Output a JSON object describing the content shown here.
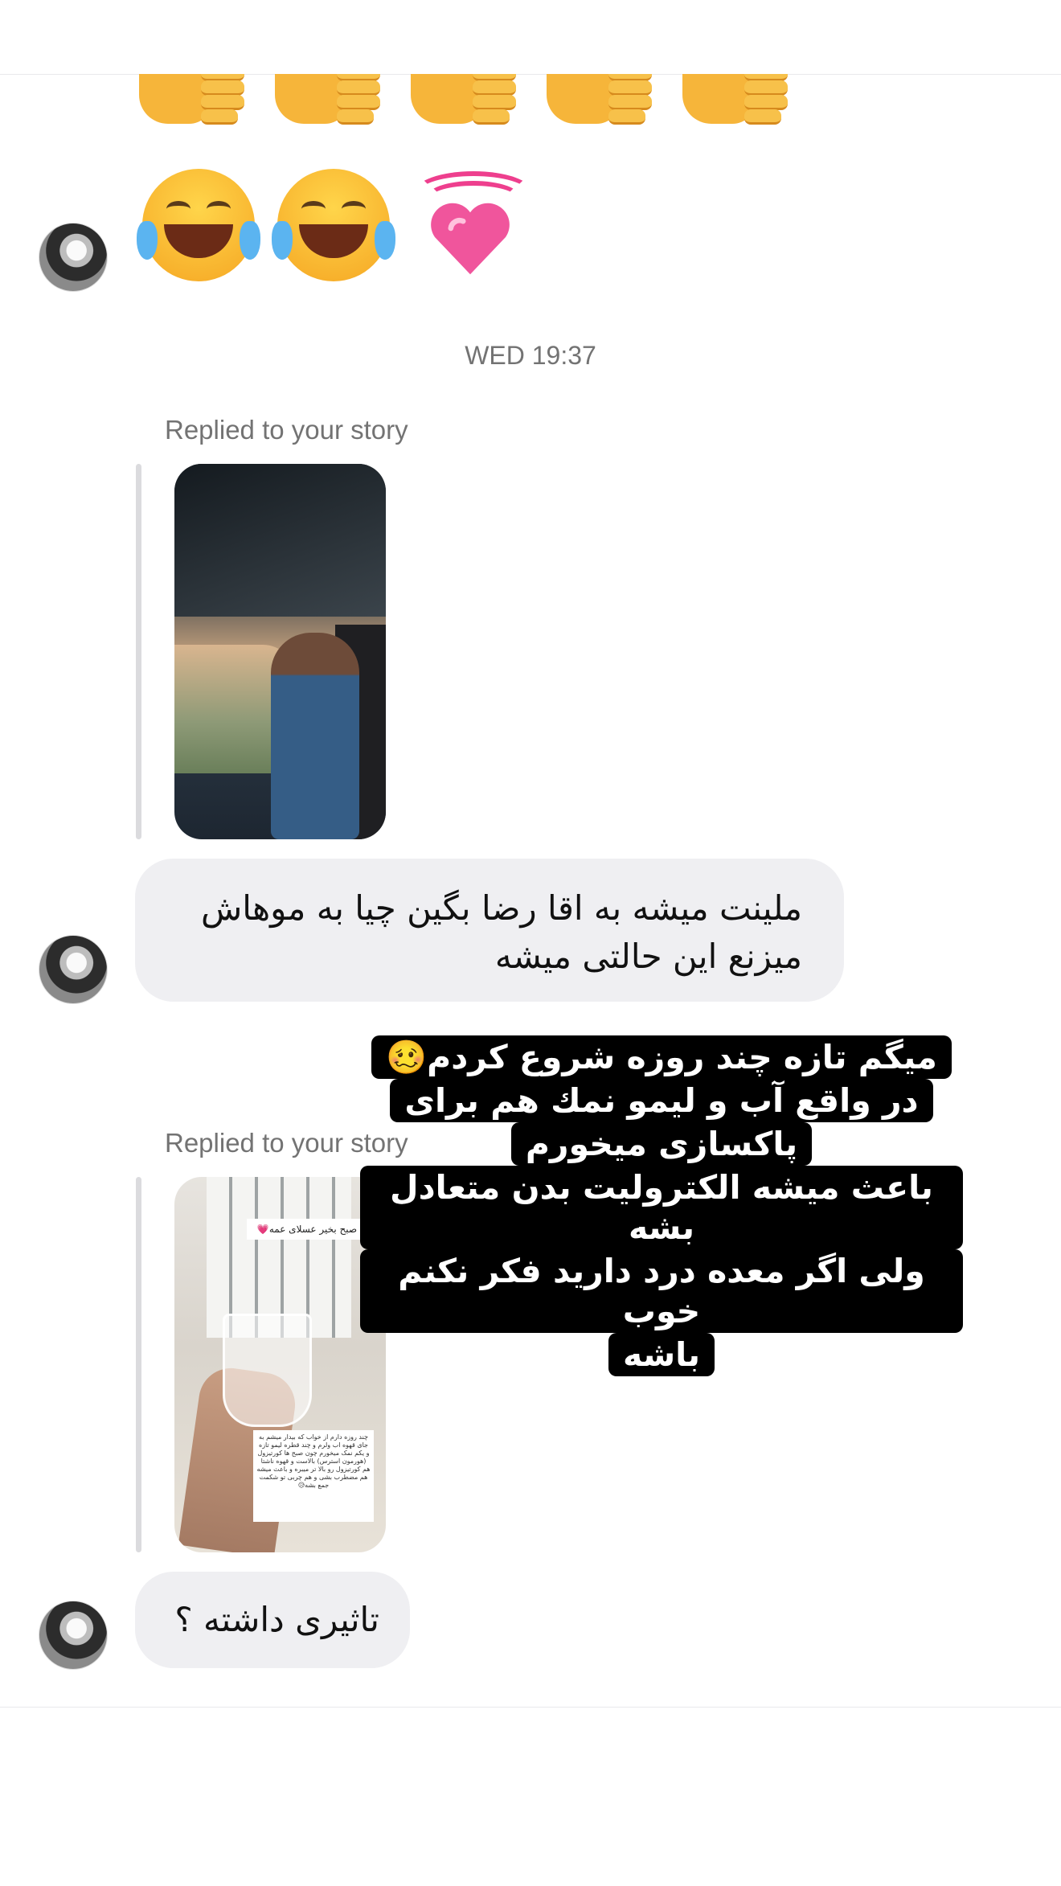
{
  "thread": {
    "timestamp": "WED 19:37",
    "reply1": {
      "label": "Replied to your story",
      "message": "ملینت میشه به اقا رضا بگین چیا به موهاش میزنع این حالتی میشه"
    },
    "reply2": {
      "label": "Replied to your story",
      "story_tag": "صبح بخیر عسلای عمه💗",
      "story_caption": "چند روزه دارم از خواب که بیدار میشم به جای قهوه اب ولرم و چند قطره لیمو تازه و یکم نمک میخورم چون صبح ها کورتیزول (هورمون استرس) بالاست و قهوه ناشتا هم کورتیزول رو بالا تر میبره و باعث میشه هم مضطرب بشی و هم چربی تو شکمت جمع بشه😥",
      "message": "تاثیری داشته ؟"
    },
    "overlay_text": {
      "line1": "میگم تازه چند روزه شروع کردم🥴",
      "line2": "در واقع آب و لیمو نمك هم برای",
      "line3": "پاکسازی میخورم",
      "line4": "باعث میشه الکترولیت بدن متعادل بشه",
      "line5": "ولی اگر معده درد دارید فکر نکنم خوب",
      "line6": "باشه"
    },
    "emojis": {
      "row1": [
        "thumbs-up",
        "thumbs-up",
        "thumbs-up",
        "thumbs-up",
        "thumbs-up"
      ],
      "row2": [
        "face-with-tears-of-joy",
        "face-with-tears-of-joy",
        "beating-heart"
      ]
    }
  }
}
